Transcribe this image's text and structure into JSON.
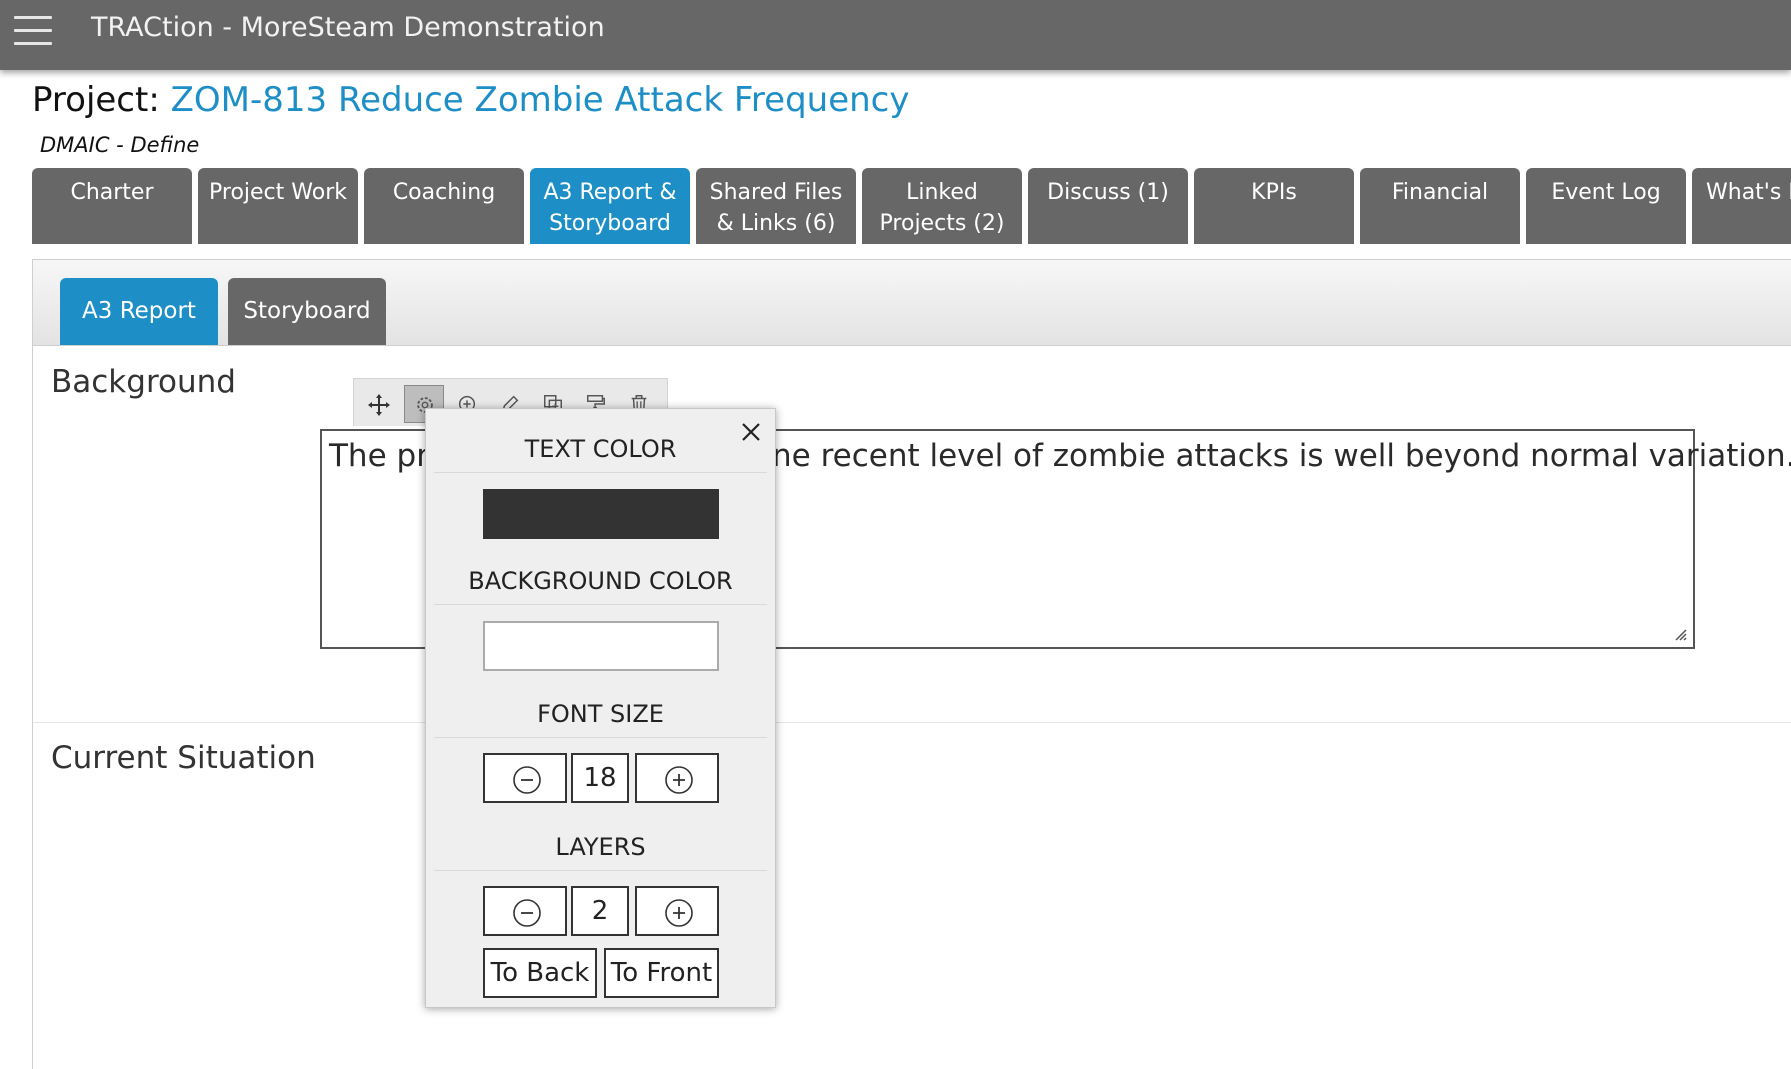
{
  "app": {
    "title": "TRACtion - MoreSteam Demonstration"
  },
  "project": {
    "label": "Project:",
    "name": "ZOM-813 Reduce Zombie Attack Frequency",
    "phase": "DMAIC - Define"
  },
  "tabs": [
    {
      "line1": "Charter",
      "line2": ""
    },
    {
      "line1": "Project Work",
      "line2": ""
    },
    {
      "line1": "Coaching",
      "line2": ""
    },
    {
      "line1": "A3 Report &",
      "line2": "Storyboard",
      "active": true
    },
    {
      "line1": "Shared Files",
      "line2": "& Links (6)"
    },
    {
      "line1": "Linked",
      "line2": "Projects (2)"
    },
    {
      "line1": "Discuss (1)",
      "line2": ""
    },
    {
      "line1": "KPIs",
      "line2": ""
    },
    {
      "line1": "Financial",
      "line2": ""
    },
    {
      "line1": "Event Log",
      "line2": ""
    },
    {
      "line1": "What's N",
      "line2": ""
    }
  ],
  "subtabs": [
    {
      "label": "A3 Report",
      "active": true
    },
    {
      "label": "Storyboard"
    }
  ],
  "sections": {
    "background": "Background",
    "current_situation": "Current Situation"
  },
  "textbox": {
    "text_left": "The pr",
    "text_right": "ne recent level of zombie attacks is well beyond normal variation."
  },
  "toolbar_icons": [
    "move-icon",
    "gear-icon",
    "zoom-in-icon",
    "pencil-icon",
    "duplicate-icon",
    "paint-roller-icon",
    "trash-icon"
  ],
  "style_popup": {
    "text_color_label": "TEXT COLOR",
    "text_color": "#333333",
    "background_color_label": "BACKGROUND COLOR",
    "background_color": "#ffffff",
    "font_size_label": "FONT SIZE",
    "font_size": "18",
    "layers_label": "LAYERS",
    "layers": "2",
    "to_back_label": "To Back",
    "to_front_label": "To Front"
  },
  "colors": {
    "accent": "#1e8fc6",
    "tab_gray": "#676767",
    "topbar": "#676767"
  }
}
